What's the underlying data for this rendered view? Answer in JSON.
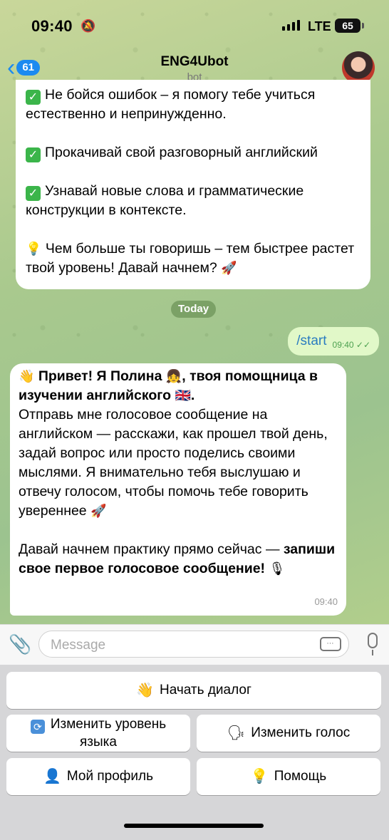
{
  "status": {
    "time": "09:40",
    "network": "LTE",
    "battery": "65"
  },
  "header": {
    "back_count": "61",
    "title": "ENG4Ubot",
    "subtitle": "bot"
  },
  "messages": {
    "first": {
      "p1": "Не бойся ошибок – я помогу тебе учиться естественно и непринужденно.",
      "p2": "Прокачивай свой разговорный английский",
      "p3": "Узнавай новые слова и грамматические конструкции в контексте.",
      "p4": "Чем больше ты говоришь – тем быстрее растет твой уровень! Давай начнем?"
    },
    "date_label": "Today",
    "outgoing": {
      "text": "/start",
      "time": "09:40"
    },
    "second": {
      "line1_bold": "Привет! Я Полина",
      "line1_bold2": ", твоя помощница в изучении английского",
      "body": "Отправь мне голосовое сообщение на английском — расскажи, как прошел твой день, задай вопрос или просто поделись своими мыслями. Я внимательно тебя выслушаю и отвечу голосом, чтобы помочь тебе говорить увереннее",
      "cta_plain": "Давай начнем практику прямо сейчас — ",
      "cta_bold": "запиши свое первое голосовое сообщение!",
      "time": "09:40"
    }
  },
  "input": {
    "placeholder": "Message"
  },
  "keyboard": {
    "start_dialog": "Начать диалог",
    "change_level": "Изменить уровень языка",
    "change_voice": "Изменить голос",
    "my_profile": "Мой профиль",
    "help": "Помощь"
  },
  "icons": {
    "check": "check-mark-button-icon",
    "bulb": "light-bulb-icon",
    "rocket": "rocket-icon",
    "wave": "waving-hand-icon",
    "girl": "girl-emoji-icon",
    "flag": "uk-flag-icon",
    "mic": "studio-microphone-icon",
    "sync": "sync-arrows-icon",
    "speaker": "speaking-head-icon",
    "user": "user-silhouette-icon"
  }
}
